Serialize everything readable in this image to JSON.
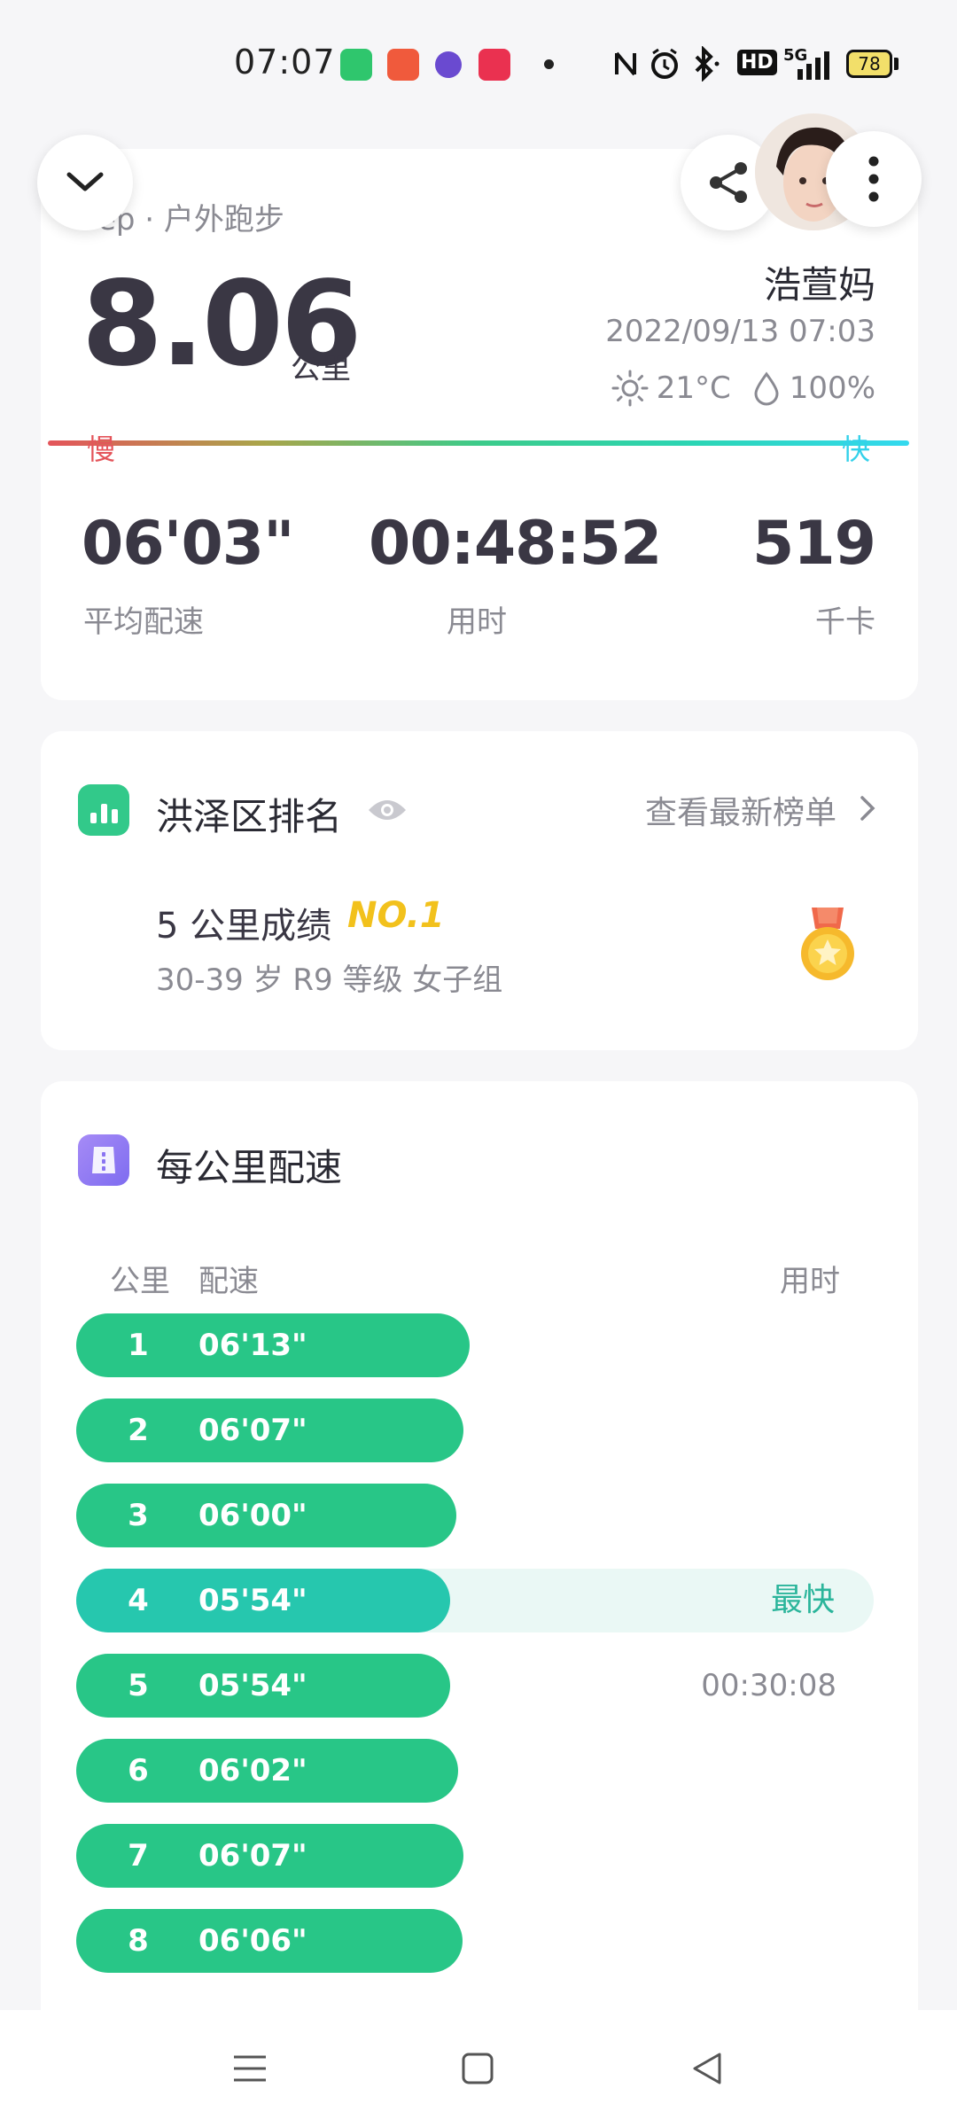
{
  "status_bar": {
    "time": "07:07",
    "network": "5G",
    "hd": "HD",
    "battery": "78"
  },
  "header": {
    "source": "ep · 户外跑步",
    "username": "浩萱妈",
    "datetime": "2022/09/13 07:03",
    "temperature": "21°C",
    "humidity": "100%"
  },
  "summary": {
    "distance": "8.06",
    "distance_unit": "公里",
    "speed_slow": "慢",
    "speed_fast": "快",
    "stats": [
      {
        "value": "06'03\"",
        "label": "平均配速"
      },
      {
        "value": "00:48:52",
        "label": "用时"
      },
      {
        "value": "519",
        "label": "千卡"
      }
    ]
  },
  "ranking": {
    "title": "洪泽区排名",
    "link": "查看最新榜单",
    "score": "5 公里成绩",
    "rank": "NO.1",
    "group": "30-39 岁 R9 等级 女子组"
  },
  "splits": {
    "title": "每公里配速",
    "col_km": "公里",
    "col_pace": "配速",
    "col_time": "用时",
    "fastest_label": "最快",
    "rows": [
      {
        "km": "1",
        "pace": "06'13\"",
        "seconds": 373,
        "time": ""
      },
      {
        "km": "2",
        "pace": "06'07\"",
        "seconds": 367,
        "time": ""
      },
      {
        "km": "3",
        "pace": "06'00\"",
        "seconds": 360,
        "time": ""
      },
      {
        "km": "4",
        "pace": "05'54\"",
        "seconds": 354,
        "time": "",
        "fastest": true
      },
      {
        "km": "5",
        "pace": "05'54\"",
        "seconds": 354,
        "time": "00:30:08"
      },
      {
        "km": "6",
        "pace": "06'02\"",
        "seconds": 362,
        "time": ""
      },
      {
        "km": "7",
        "pace": "06'07\"",
        "seconds": 367,
        "time": ""
      },
      {
        "km": "8",
        "pace": "06'06\"",
        "seconds": 366,
        "time": ""
      }
    ]
  },
  "colors": {
    "accent_green": "#28c687",
    "fastest_teal": "#26c7ae",
    "rank_gold": "#f2c11c"
  }
}
